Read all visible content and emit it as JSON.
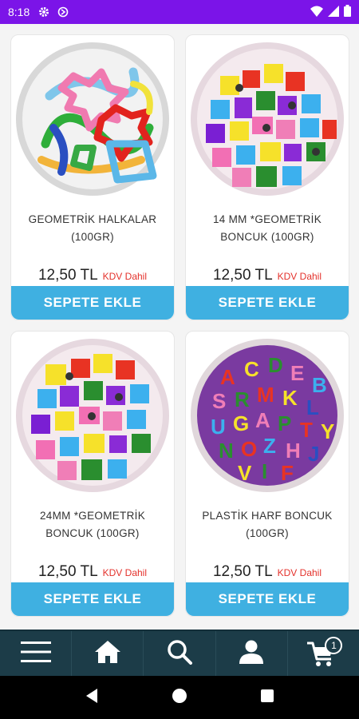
{
  "status_bar": {
    "time": "8:18"
  },
  "products": [
    {
      "name_line1": "GEOMETRİK HALKALAR",
      "name_line2": "(100GR)",
      "price": "12,50 TL",
      "tax": "KDV Dahil",
      "button": "SEPETE EKLE",
      "image": "rings"
    },
    {
      "name_line1": "14 MM *GEOMETRİK",
      "name_line2": "BONCUK (100GR)",
      "price": "12,50 TL",
      "tax": "KDV Dahil",
      "button": "SEPETE EKLE",
      "image": "beads"
    },
    {
      "name_line1": "24MM *GEOMETRİK",
      "name_line2": "BONCUK (100GR)",
      "price": "12,50 TL",
      "tax": "KDV Dahil",
      "button": "SEPETE EKLE",
      "image": "beads"
    },
    {
      "name_line1": "PLASTİK HARF BONCUK",
      "name_line2": "(100GR)",
      "price": "12,50 TL",
      "tax": "KDV Dahil",
      "button": "SEPETE EKLE",
      "image": "letters"
    }
  ],
  "bottom_nav": {
    "items": [
      "menu-icon",
      "home-icon",
      "search-icon",
      "account-icon",
      "cart-icon"
    ],
    "cart_count": "1"
  },
  "colors": {
    "status_bar": "#7b14e8",
    "button": "#3fb0e1",
    "nav": "#1c3c48",
    "tax": "#e4312b"
  }
}
